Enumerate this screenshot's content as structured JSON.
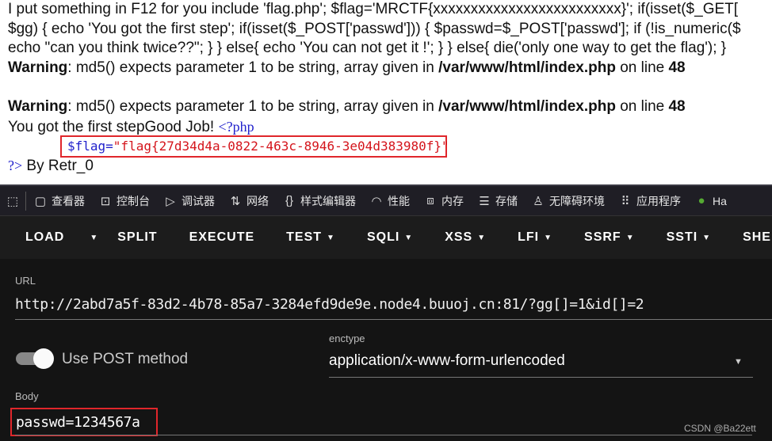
{
  "page": {
    "lines": [
      "I put something in F12 for you include 'flag.php'; $flag='MRCTF{xxxxxxxxxxxxxxxxxxxxxxxxx}'; if(isset($_GET[",
      "$gg) { echo 'You got the first step'; if(isset($_POST['passwd'])) { $passwd=$_POST['passwd']; if (!is_numeric($",
      "echo \"can you think twice??\"; } } else{ echo 'You can not get it !'; } } else{ die('only one way to get the flag'); }"
    ],
    "warning": {
      "label": "Warning",
      "msg": ": md5() expects parameter 1 to be string, array given in ",
      "path": "/var/www/html/index.php",
      "online": " on line ",
      "line": "48"
    },
    "first_step": "You got the first stepGood Job! ",
    "php_open": "<?php",
    "flag_var": "$flag=",
    "flag_value": "\"flag{27d34d4a-0822-463c-8946-3e04d383980f}\"",
    "php_close": "?>",
    "byline": " By Retr_0"
  },
  "devtools": {
    "tabs": [
      "查看器",
      "控制台",
      "调试器",
      "网络",
      "样式编辑器",
      "性能",
      "内存",
      "存储",
      "无障碍环境",
      "应用程序",
      "Ha"
    ]
  },
  "hackbar": {
    "menu": [
      "LOAD",
      "SPLIT",
      "EXECUTE",
      "TEST",
      "SQLI",
      "XSS",
      "LFI",
      "SSRF",
      "SSTI",
      "SHELL"
    ],
    "url_label": "URL",
    "url": "http://2abd7a5f-83d2-4b78-85a7-3284efd9de9e.node4.buuoj.cn:81/?gg[]=1&id[]=2",
    "post_label": "Use POST method",
    "post_enabled": true,
    "enctype_label": "enctype",
    "enctype": "application/x-www-form-urlencoded",
    "body_label": "Body",
    "body": "passwd=1234567a",
    "watermark": "CSDN @Ba22ett"
  },
  "colors": {
    "highlight": "#e0262b",
    "php_tag": "#2222cc",
    "flag_string": "#d4141b"
  }
}
